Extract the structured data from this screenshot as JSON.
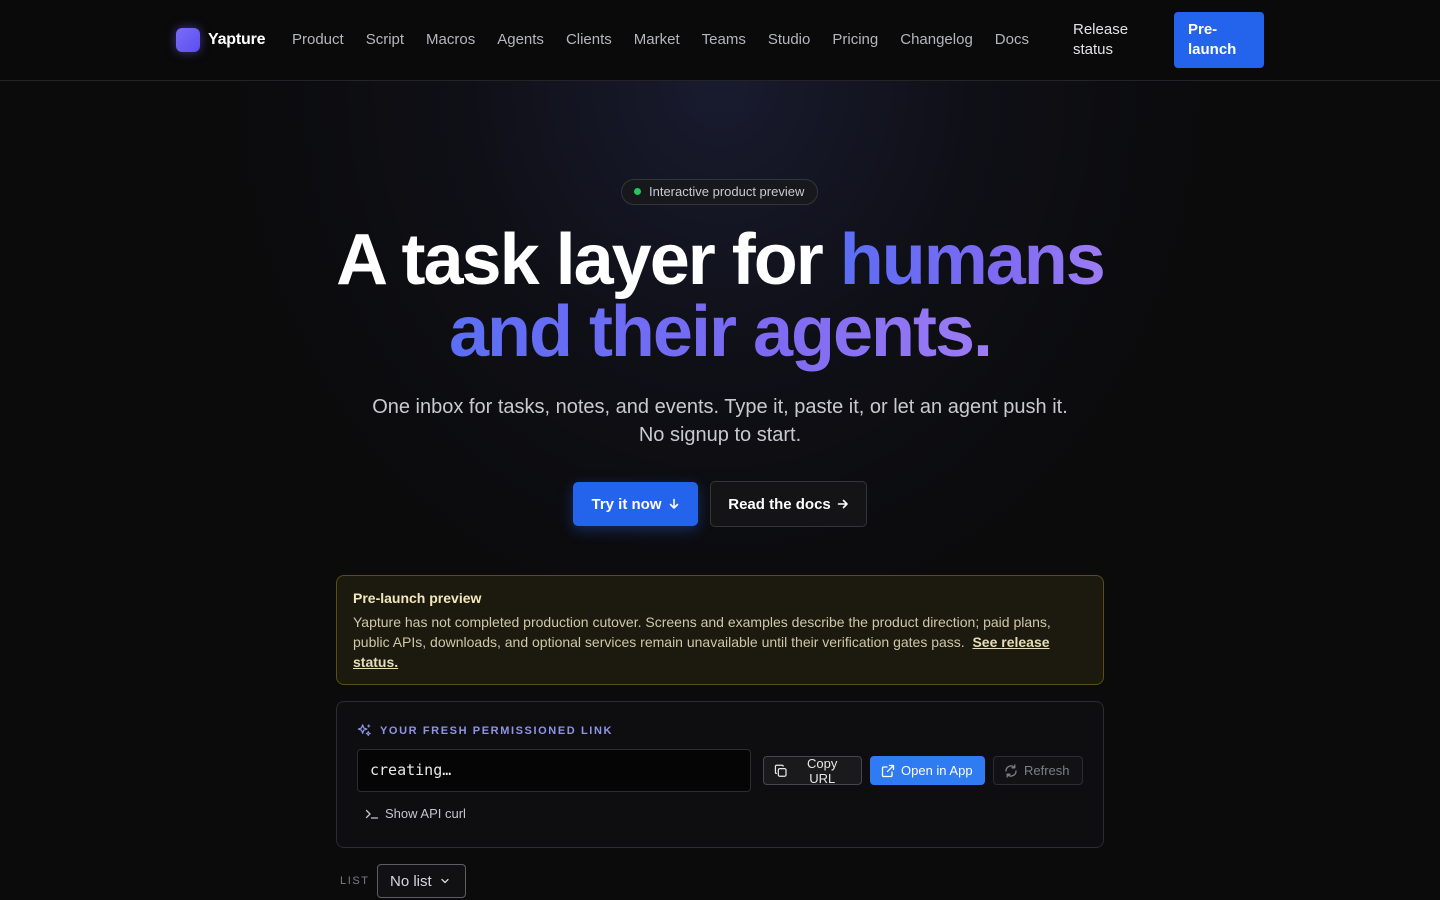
{
  "nav": {
    "brand": "Yapture",
    "links": [
      "Product",
      "Script",
      "Macros",
      "Agents",
      "Clients",
      "Market",
      "Teams",
      "Studio",
      "Pricing",
      "Changelog",
      "Docs"
    ],
    "release_status": "Release status",
    "prelaunch": "Pre-launch"
  },
  "hero": {
    "badge": "Interactive product preview",
    "headline_plain": "A task layer for",
    "headline_accent_1": "humans",
    "headline_accent_2": "and their agents.",
    "subtitle": "One inbox for tasks, notes, and events. Type it, paste it, or let an agent push it. No signup to start.",
    "cta_primary": "Try it now",
    "cta_secondary": "Read the docs"
  },
  "notice": {
    "title": "Pre-launch preview",
    "body": "Yapture has not completed production cutover. Screens and examples describe the product direction; paid plans, public APIs, downloads, and optional services remain unavailable until their verification gates pass.",
    "link": "See release status."
  },
  "link_panel": {
    "title": "YOUR FRESH PERMISSIONED LINK",
    "url_value": "creating…",
    "copy_label": "Copy URL",
    "open_label": "Open in App",
    "refresh_label": "Refresh",
    "show_curl": "Show API curl"
  },
  "list": {
    "label": "LIST",
    "selected": "No list"
  },
  "colors": {
    "accent": "#2463eb",
    "gradient_start": "#5b6ef5",
    "gradient_end": "#9c7cf4",
    "status_dot": "#22c55e",
    "notice_border": "#5a4d1a"
  }
}
